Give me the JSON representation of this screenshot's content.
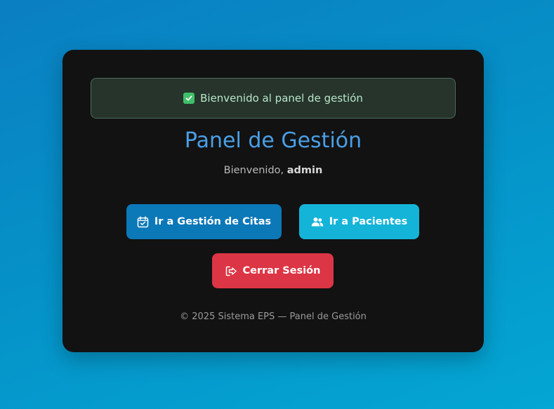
{
  "alert": {
    "message": "Bienvenido al panel de gestión",
    "icon": "check-square-icon",
    "color": "#3fbf6a"
  },
  "header": {
    "title": "Panel de Gestión",
    "welcome_prefix": "Bienvenido,",
    "username": "admin"
  },
  "actions": {
    "citas": {
      "label": "Ir a Gestión de Citas",
      "icon": "calendar-check-icon",
      "color": "#0b78b8"
    },
    "pacientes": {
      "label": "Ir a Pacientes",
      "icon": "users-icon",
      "color": "#14b4d8"
    },
    "logout": {
      "label": "Cerrar Sesión",
      "icon": "sign-out-icon",
      "color": "#dc3545"
    }
  },
  "footer": {
    "text": "© 2025 Sistema EPS — Panel de Gestión"
  },
  "colors": {
    "title": "#4a9fe6",
    "card_bg": "#121212"
  }
}
